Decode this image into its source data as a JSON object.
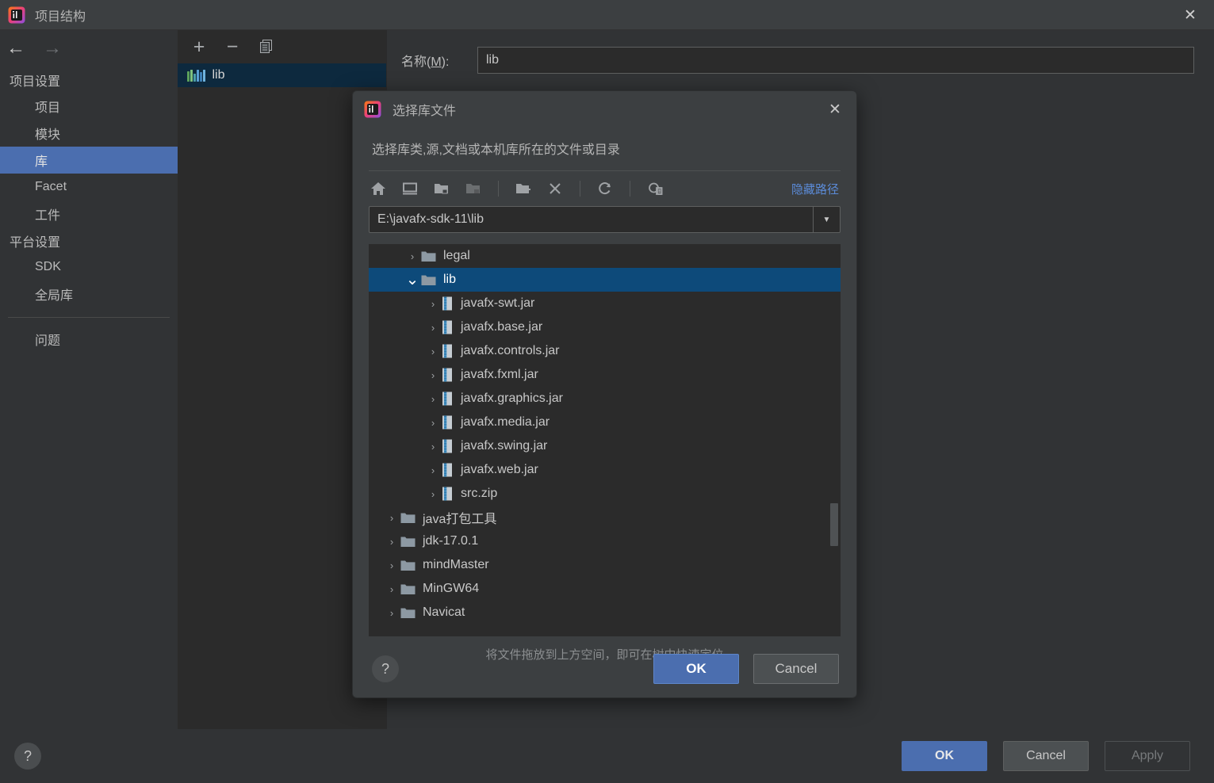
{
  "window": {
    "title": "项目结构",
    "close_label": "✕",
    "app_icon": "intellij-idea-icon"
  },
  "nav": {
    "back": "←",
    "forward": "→"
  },
  "sidebar": {
    "groups": [
      {
        "label": "项目设置",
        "items": [
          {
            "label": "项目",
            "selected": false
          },
          {
            "label": "模块",
            "selected": false
          },
          {
            "label": "库",
            "selected": true
          },
          {
            "label": "Facet",
            "selected": false
          },
          {
            "label": "工件",
            "selected": false
          }
        ]
      },
      {
        "label": "平台设置",
        "items": [
          {
            "label": "SDK",
            "selected": false
          },
          {
            "label": "全局库",
            "selected": false
          }
        ]
      }
    ],
    "problems_label": "问题"
  },
  "library_pane": {
    "toolbar": {
      "add": "+",
      "remove": "−",
      "copy": "copy-icon"
    },
    "items": [
      {
        "label": "lib",
        "icon": "library-icon",
        "selected": true
      }
    ]
  },
  "name_field": {
    "label_prefix": "名称(",
    "label_mnemonic": "M",
    "label_suffix": "):",
    "value": "lib"
  },
  "footer": {
    "help": "?",
    "ok": "OK",
    "cancel": "Cancel",
    "apply": "Apply"
  },
  "modal": {
    "title": "选择库文件",
    "icon": "intellij-idea-icon",
    "close_label": "✕",
    "description": "选择库类,源,文档或本机库所在的文件或目录",
    "toolbar": [
      {
        "name": "home-icon",
        "enabled": true
      },
      {
        "name": "desktop-icon",
        "enabled": true
      },
      {
        "name": "collapse-folder-icon",
        "enabled": true
      },
      {
        "name": "expand-folder-icon",
        "enabled": false
      },
      {
        "name": "new-folder-icon",
        "enabled": true
      },
      {
        "name": "delete-icon",
        "enabled": true
      },
      {
        "name": "refresh-icon",
        "enabled": true
      },
      {
        "name": "show-hidden-icon",
        "enabled": true
      }
    ],
    "hide_path_label": "隐藏路径",
    "path": {
      "value": "E:\\javafx-sdk-11\\lib",
      "dropdown_arrow": "▼"
    },
    "tree": [
      {
        "label": "legal",
        "type": "folder",
        "indent": 1,
        "expanded": false,
        "selected": false
      },
      {
        "label": "lib",
        "type": "folder",
        "indent": 1,
        "expanded": true,
        "selected": true
      },
      {
        "label": "javafx-swt.jar",
        "type": "jar",
        "indent": 2,
        "expanded": false,
        "selected": false
      },
      {
        "label": "javafx.base.jar",
        "type": "jar",
        "indent": 2,
        "expanded": false,
        "selected": false
      },
      {
        "label": "javafx.controls.jar",
        "type": "jar",
        "indent": 2,
        "expanded": false,
        "selected": false
      },
      {
        "label": "javafx.fxml.jar",
        "type": "jar",
        "indent": 2,
        "expanded": false,
        "selected": false
      },
      {
        "label": "javafx.graphics.jar",
        "type": "jar",
        "indent": 2,
        "expanded": false,
        "selected": false
      },
      {
        "label": "javafx.media.jar",
        "type": "jar",
        "indent": 2,
        "expanded": false,
        "selected": false
      },
      {
        "label": "javafx.swing.jar",
        "type": "jar",
        "indent": 2,
        "expanded": false,
        "selected": false
      },
      {
        "label": "javafx.web.jar",
        "type": "jar",
        "indent": 2,
        "expanded": false,
        "selected": false
      },
      {
        "label": "src.zip",
        "type": "jar",
        "indent": 2,
        "expanded": false,
        "selected": false
      },
      {
        "label": "java打包工具",
        "type": "folder",
        "indent": 0,
        "expanded": false,
        "selected": false
      },
      {
        "label": "jdk-17.0.1",
        "type": "folder",
        "indent": 0,
        "expanded": false,
        "selected": false
      },
      {
        "label": "mindMaster",
        "type": "folder",
        "indent": 0,
        "expanded": false,
        "selected": false
      },
      {
        "label": "MinGW64",
        "type": "folder",
        "indent": 0,
        "expanded": false,
        "selected": false
      },
      {
        "label": "Navicat",
        "type": "folder",
        "indent": 0,
        "expanded": false,
        "selected": false
      }
    ],
    "drop_hint": "将文件拖放到上方空间，即可在树中快速定位",
    "help": "?",
    "ok": "OK",
    "cancel": "Cancel"
  },
  "colors": {
    "accent_blue": "#4b6eaf",
    "tree_selection": "#0d4a7a",
    "lib_selection": "#0d293e",
    "link_blue": "#5b8bd8",
    "window_bg": "#313335",
    "pane_bg": "#2b2b2b",
    "modal_bg": "#3c3f41"
  }
}
